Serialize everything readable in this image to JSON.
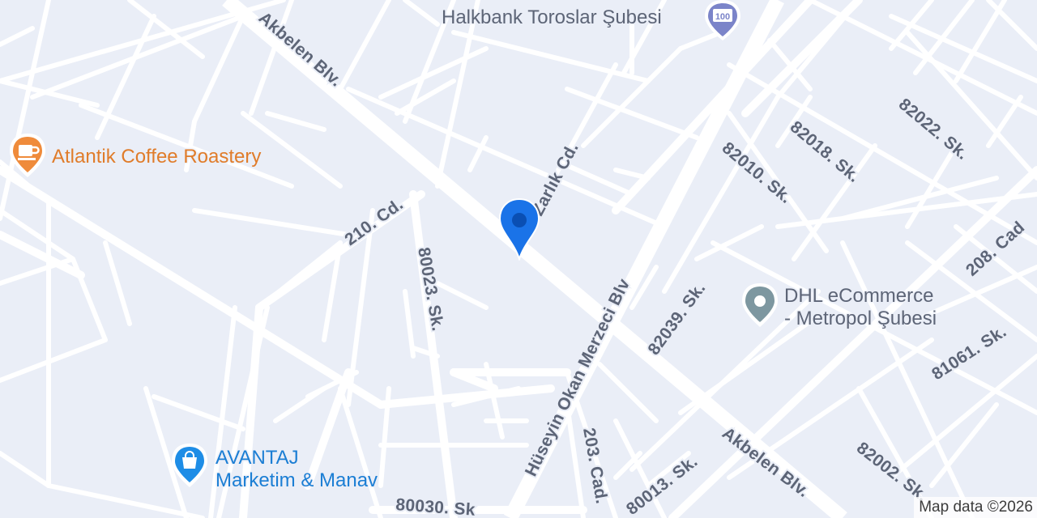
{
  "map": {
    "background_color": "#eaeef7",
    "road_color": "#ffffff",
    "label_color": "#5d6577",
    "selected_marker": {
      "icon": "map-pin-icon",
      "color": "#1a73e8"
    },
    "pois": [
      {
        "key": "halkbank",
        "name": "Halkbank Toroslar Şubesi",
        "icon": "bank-icon",
        "color": "#7b84c9"
      },
      {
        "key": "atlantik",
        "name": "Atlantik Coffee Roastery",
        "icon": "coffee-cup-icon",
        "color": "#ef8b3b"
      },
      {
        "key": "dhl",
        "name_line1": "DHL eCommerce",
        "name_line2": "- Metropol Şubesi",
        "icon": "generic-place-icon",
        "color": "#7d97a0"
      },
      {
        "key": "avantaj",
        "name_line1": "AVANTAJ",
        "name_line2": "Marketim & Manav",
        "icon": "shopping-bag-icon",
        "color": "#1e8de6"
      }
    ],
    "road_labels": {
      "akbelen_1": "Akbelen Blv.",
      "akbelen_2": "Akbelen Blv.",
      "huseyin": "Hüseyin Okan Merzeci Blv",
      "zarlik": "Zarlık Cd.",
      "cd_210": "210. Cd.",
      "sk_80023": "80023. Sk.",
      "sk_82018": "82018. Sk.",
      "sk_82010": "82010. Sk.",
      "sk_82022": "82022. Sk.",
      "cad_208": "208. Cad",
      "sk_82039": "82039. Sk.",
      "sk_81061": "81061. Sk.",
      "cad_203": "203. Cad.",
      "sk_80013": "80013. Sk.",
      "sk_82002": "82002. Sk.",
      "sk_80030": "80030. Sk"
    },
    "attribution": "Map data ©2026"
  }
}
